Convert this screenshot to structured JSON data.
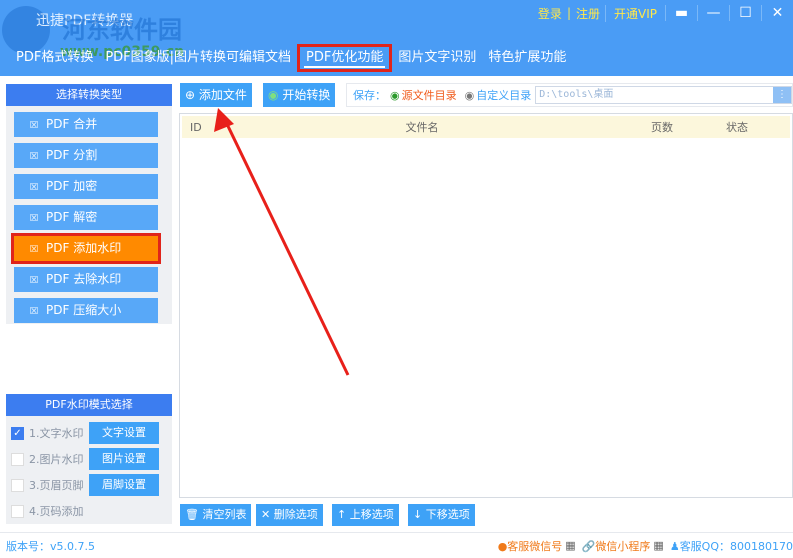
{
  "app": {
    "title": "迅捷PDF转换器",
    "watermark": "河东软件园",
    "watermark_url": "www.pc0359.cn"
  },
  "topbar": {
    "login": "登录",
    "sep": "|",
    "register": "注册",
    "vip": "开通VIP"
  },
  "tabs": [
    "PDF格式转换",
    "PDF图象版|图片转换可编辑文档",
    "PDF优化功能",
    "图片文字识别",
    "特色扩展功能"
  ],
  "left": {
    "header": "选择转换类型",
    "items": [
      "PDF 合并",
      "PDF 分割",
      "PDF 加密",
      "PDF 解密",
      "PDF 添加水印",
      "PDF 去除水印",
      "PDF 压缩大小"
    ],
    "icon": "PDF"
  },
  "watermark_mode": {
    "header": "PDF水印模式选择",
    "rows": [
      {
        "label": "1.文字水印",
        "checked": true,
        "button": "文字设置"
      },
      {
        "label": "2.图片水印",
        "checked": false,
        "button": "图片设置"
      },
      {
        "label": "3.页眉页脚",
        "checked": false,
        "button": "眉脚设置"
      },
      {
        "label": "4.页码添加",
        "checked": false
      }
    ]
  },
  "toolbar": {
    "add": "添加文件",
    "start": "开始转换",
    "save_label": "保存：",
    "opt_source": "源文件目录",
    "opt_custom": "自定义目录",
    "path": "D:\\tools\\桌面"
  },
  "table": {
    "columns": [
      "ID",
      "文件名",
      "页数",
      "状态"
    ]
  },
  "bottom": {
    "clear": "清空列表",
    "delete": "删除选项",
    "up": "上移选项",
    "down": "下移选项"
  },
  "status": {
    "version": "版本号：v5.0.7.5",
    "wechat": "客服微信号",
    "mini": "微信小程序",
    "qq": "客服QQ：800180170"
  }
}
